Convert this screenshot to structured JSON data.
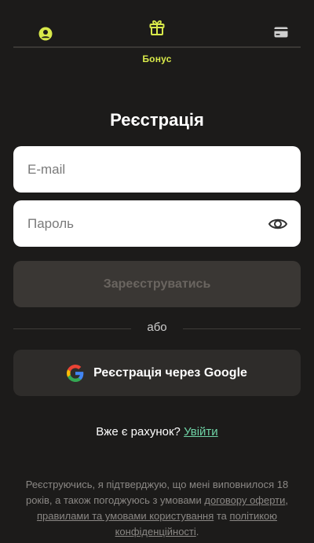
{
  "steps": {
    "user_icon": "user-circle-icon",
    "bonus_icon": "gift-icon",
    "bonus_label": "Бонус",
    "card_icon": "card-icon",
    "accent_color": "#d8e94a"
  },
  "title": "Реєстрація",
  "email": {
    "placeholder": "E-mail",
    "value": ""
  },
  "password": {
    "placeholder": "Пароль",
    "value": "",
    "icon": "eye-icon"
  },
  "register_button": "Зареєструватись",
  "or_text": "або",
  "google_button": "Реєстрація через Google",
  "login_prompt": {
    "text": "Вже є рахунок?",
    "link": "Увійти"
  },
  "legal": {
    "text_1": "Реєструючись, я підтверджую, що мені виповнилося 18 років, а також погоджуюсь з умовами ",
    "link_offer": "договору оферти",
    "text_2": ", ",
    "link_rules": "правилами та умовами користування",
    "text_3": " та ",
    "link_privacy": "політикою конфіденційності",
    "text_4": "."
  }
}
